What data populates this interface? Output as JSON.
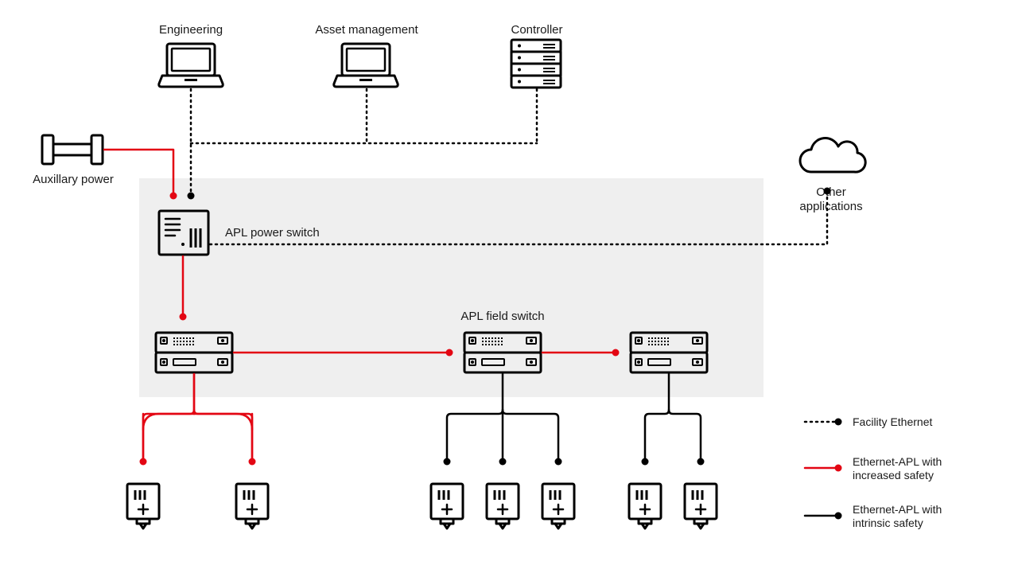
{
  "labels": {
    "engineering": "Engineering",
    "asset_mgmt": "Asset management",
    "controller": "Controller",
    "aux_power": "Auxillary power",
    "apl_power_switch": "APL power switch",
    "apl_field_switch": "APL field switch",
    "other_applications_1": "Other",
    "other_applications_2": "applications"
  },
  "legend": {
    "facility_ethernet": "Facility Ethernet",
    "apl_increased_1": "Ethernet-APL with",
    "apl_increased_2": "increased safety",
    "apl_intrinsic_1": "Ethernet-APL with",
    "apl_intrinsic_2": "intrinsic safety"
  },
  "diagram": {
    "type": "network-topology",
    "nodes": [
      {
        "id": "engineering",
        "type": "laptop",
        "role": "client"
      },
      {
        "id": "asset_mgmt",
        "type": "laptop",
        "role": "client"
      },
      {
        "id": "controller",
        "type": "server",
        "role": "controller"
      },
      {
        "id": "aux_power",
        "type": "power-supply"
      },
      {
        "id": "apl_power_switch",
        "type": "switch"
      },
      {
        "id": "other_applications",
        "type": "cloud"
      },
      {
        "id": "field_switch_1",
        "type": "field-switch"
      },
      {
        "id": "field_switch_2",
        "type": "field-switch"
      },
      {
        "id": "field_switch_3",
        "type": "field-switch"
      },
      {
        "id": "device_1",
        "type": "field-device"
      },
      {
        "id": "device_2",
        "type": "field-device"
      },
      {
        "id": "device_3",
        "type": "field-device"
      },
      {
        "id": "device_4",
        "type": "field-device"
      },
      {
        "id": "device_5",
        "type": "field-device"
      },
      {
        "id": "device_6",
        "type": "field-device"
      },
      {
        "id": "device_7",
        "type": "field-device"
      }
    ],
    "edges": [
      {
        "from": "engineering",
        "to": "apl_power_switch",
        "link": "facility-ethernet"
      },
      {
        "from": "asset_mgmt",
        "to": "apl_power_switch",
        "link": "facility-ethernet"
      },
      {
        "from": "controller",
        "to": "apl_power_switch",
        "link": "facility-ethernet"
      },
      {
        "from": "apl_power_switch",
        "to": "other_applications",
        "link": "facility-ethernet"
      },
      {
        "from": "aux_power",
        "to": "apl_power_switch",
        "link": "apl-increased-safety"
      },
      {
        "from": "apl_power_switch",
        "to": "field_switch_1",
        "link": "apl-increased-safety"
      },
      {
        "from": "field_switch_1",
        "to": "field_switch_2",
        "link": "apl-increased-safety"
      },
      {
        "from": "field_switch_2",
        "to": "field_switch_3",
        "link": "apl-increased-safety"
      },
      {
        "from": "field_switch_1",
        "to": "device_1",
        "link": "apl-increased-safety"
      },
      {
        "from": "field_switch_1",
        "to": "device_2",
        "link": "apl-increased-safety"
      },
      {
        "from": "field_switch_2",
        "to": "device_3",
        "link": "apl-intrinsic-safety"
      },
      {
        "from": "field_switch_2",
        "to": "device_4",
        "link": "apl-intrinsic-safety"
      },
      {
        "from": "field_switch_2",
        "to": "device_5",
        "link": "apl-intrinsic-safety"
      },
      {
        "from": "field_switch_3",
        "to": "device_6",
        "link": "apl-intrinsic-safety"
      },
      {
        "from": "field_switch_3",
        "to": "device_7",
        "link": "apl-intrinsic-safety"
      }
    ],
    "link_types": {
      "facility-ethernet": {
        "style": "dotted",
        "color": "black"
      },
      "apl-increased-safety": {
        "style": "solid",
        "color": "red"
      },
      "apl-intrinsic-safety": {
        "style": "solid",
        "color": "black"
      }
    }
  }
}
